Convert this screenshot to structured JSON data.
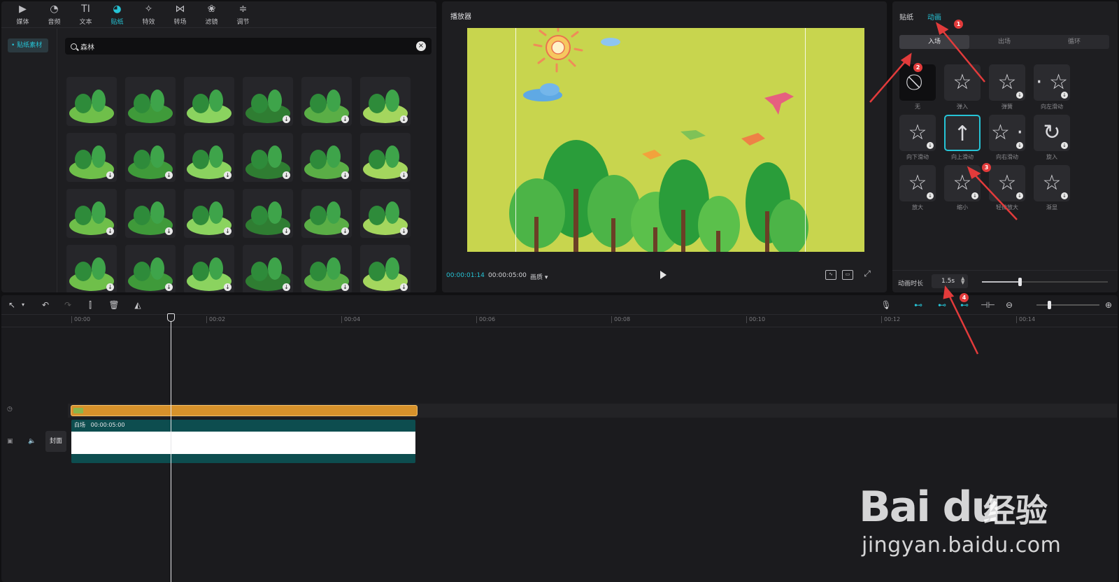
{
  "toolbar_tabs": [
    {
      "icon": "media-icon",
      "label": "媒体"
    },
    {
      "icon": "audio-icon",
      "label": "音频"
    },
    {
      "icon": "text-icon",
      "label": "文本"
    },
    {
      "icon": "sticker-icon",
      "label": "贴纸"
    },
    {
      "icon": "effects-icon",
      "label": "特效"
    },
    {
      "icon": "transition-icon",
      "label": "转场"
    },
    {
      "icon": "filter-icon",
      "label": "滤镜"
    },
    {
      "icon": "adjust-icon",
      "label": "调节"
    }
  ],
  "active_tab": "贴纸",
  "sticker_sidebar": {
    "item": "• 贴纸素材"
  },
  "search": {
    "value": "森林"
  },
  "player": {
    "title": "播放器",
    "current_time": "00:00:01:14",
    "total_time": "00:00:05:00",
    "quality": "画质 ▾"
  },
  "props": {
    "tabs": [
      "贴纸",
      "动画"
    ],
    "active_tab": "动画",
    "segments": [
      "入场",
      "出场",
      "循环"
    ],
    "active_segment": "入场",
    "animations": [
      {
        "label": "无",
        "glyph": "⃠",
        "download": false
      },
      {
        "label": "弹入",
        "glyph": "☆",
        "download": false
      },
      {
        "label": "弹簧",
        "glyph": "☆",
        "download": true
      },
      {
        "label": "向左滑动",
        "glyph": "· ☆",
        "download": true
      },
      {
        "label": "向下滑动",
        "glyph": "☆",
        "download": true
      },
      {
        "label": "向上滑动",
        "glyph": "↑",
        "download": false,
        "selected": true
      },
      {
        "label": "向右滑动",
        "glyph": "☆ ·",
        "download": true
      },
      {
        "label": "旋入",
        "glyph": "↻",
        "download": true
      },
      {
        "label": "放大",
        "glyph": "☆",
        "download": true
      },
      {
        "label": "缩小",
        "glyph": "☆",
        "download": true
      },
      {
        "label": "轻微放大",
        "glyph": "☆",
        "download": true
      },
      {
        "label": "渐显",
        "glyph": "☆",
        "download": true
      }
    ],
    "duration_label": "动画时长",
    "duration_value": "1.5s",
    "duration_fraction": 0.3
  },
  "timeline": {
    "ruler": [
      "00:00",
      "00:02",
      "00:04",
      "00:06",
      "00:08",
      "00:10",
      "00:12",
      "00:14"
    ],
    "video_clip_name": "白场",
    "video_clip_duration": "00:00:05:00",
    "cover_label": "封面"
  },
  "annotations": [
    "1",
    "2",
    "3",
    "4"
  ],
  "watermark": {
    "brand": "Bai du",
    "cn": "经验",
    "url": "jingyan.baidu.com"
  },
  "colors": {
    "accent": "#26c4d6",
    "stage_bg": "#c8d54e",
    "sticker_clip": "#d7922b",
    "video_clip": "#0d4d4f",
    "marker": "#e23b3b"
  }
}
